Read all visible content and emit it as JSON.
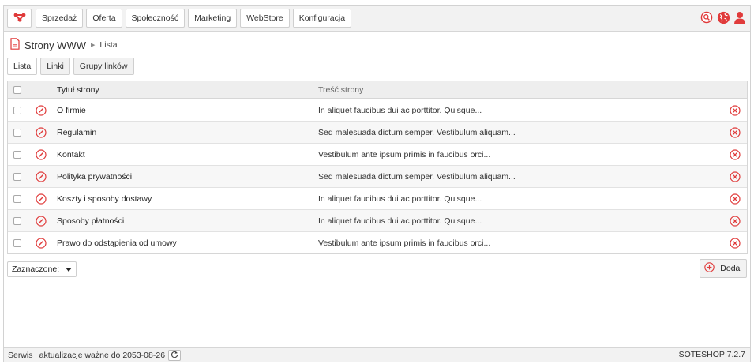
{
  "nav": {
    "items": [
      "Sprzedaż",
      "Oferta",
      "Społeczność",
      "Marketing",
      "WebStore",
      "Konfiguracja"
    ]
  },
  "breadcrumb": {
    "title": "Strony WWW",
    "current": "Lista"
  },
  "subtabs": [
    "Lista",
    "Linki",
    "Grupy linków"
  ],
  "table": {
    "headers": {
      "title": "Tytuł strony",
      "content": "Treść strony"
    },
    "rows": [
      {
        "title": "O firmie",
        "content": "In aliquet faucibus dui ac porttitor. Quisque..."
      },
      {
        "title": "Regulamin",
        "content": "Sed malesuada dictum semper. Vestibulum aliquam..."
      },
      {
        "title": "Kontakt",
        "content": "Vestibulum ante ipsum primis in faucibus orci..."
      },
      {
        "title": "Polityka prywatności",
        "content": "Sed malesuada dictum semper. Vestibulum aliquam..."
      },
      {
        "title": "Koszty i sposoby dostawy",
        "content": "In aliquet faucibus dui ac porttitor. Quisque..."
      },
      {
        "title": "Sposoby płatności",
        "content": "In aliquet faucibus dui ac porttitor. Quisque..."
      },
      {
        "title": "Prawo do odstąpienia od umowy",
        "content": "Vestibulum ante ipsum primis in faucibus orci..."
      }
    ]
  },
  "bulk": {
    "label": "Zaznaczone:"
  },
  "add_button": {
    "label": "Dodaj"
  },
  "footer": {
    "service": "Serwis i aktualizacje ważne do 2053-08-26",
    "version": "SOTESHOP 7.2.7"
  },
  "colors": {
    "accent": "#e03a3a",
    "toolbar_bg": "#f2f2f2",
    "border": "#cfcfcf"
  },
  "icons": [
    "logo-icon",
    "search-icon",
    "globe-icon",
    "user-icon",
    "document-icon",
    "edit-icon",
    "delete-icon",
    "add-icon",
    "refresh-icon"
  ]
}
